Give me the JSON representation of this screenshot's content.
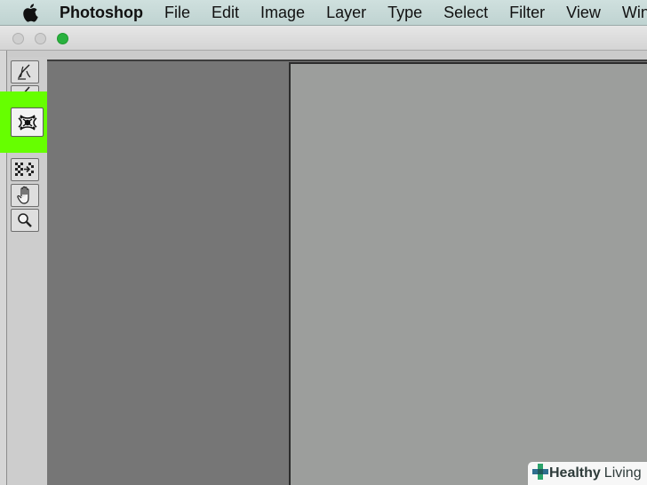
{
  "menubar": {
    "items": [
      "Photoshop",
      "File",
      "Edit",
      "Image",
      "Layer",
      "Type",
      "Select",
      "Filter",
      "View",
      "Wind"
    ]
  },
  "toolbox": {
    "tools": [
      "brush-tool-icon",
      "pencil-tool-icon",
      "puppet-warp-tool-icon",
      "pucker-tool-icon",
      "checker-move-tool-icon",
      "hand-tool-icon",
      "zoom-tool-icon"
    ]
  },
  "colors": {
    "highlight": "#66ff00",
    "pasteboard": "#767676",
    "canvas": "#9c9e9c"
  },
  "watermark": {
    "brand": "Healthy",
    "brand2": "Living"
  }
}
